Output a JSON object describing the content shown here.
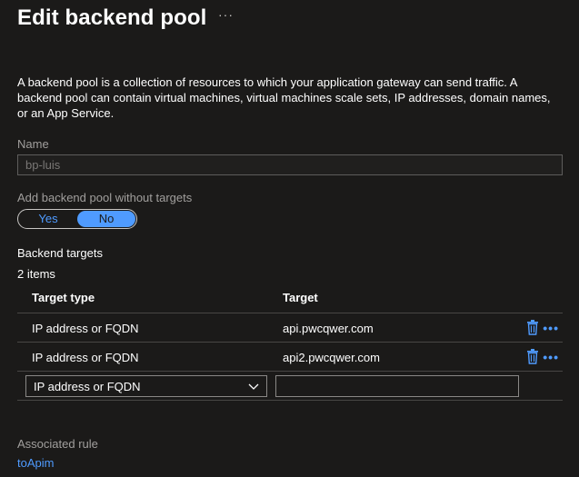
{
  "header": {
    "title": "Edit backend pool",
    "more_label": "···"
  },
  "description": "A backend pool is a collection of resources to which your application gateway can send traffic. A backend pool can contain virtual machines, virtual machines scale sets, IP addresses, domain names, or an App Service.",
  "name_field": {
    "label": "Name",
    "value": "bp-luis"
  },
  "without_targets": {
    "label": "Add backend pool without targets",
    "yes_label": "Yes",
    "no_label": "No",
    "selected": "No"
  },
  "backend_targets": {
    "heading": "Backend targets",
    "count_text": "2 items",
    "columns": [
      "Target type",
      "Target"
    ],
    "rows": [
      {
        "type": "IP address or FQDN",
        "target": "api.pwcqwer.com"
      },
      {
        "type": "IP address or FQDN",
        "target": "api2.pwcqwer.com"
      }
    ],
    "new_row": {
      "type_selected": "IP address or FQDN",
      "target_value": ""
    }
  },
  "associated_rule": {
    "label": "Associated rule",
    "link_text": "toApim"
  },
  "colors": {
    "background": "#1b1a19",
    "accent": "#4f9bff",
    "muted_text": "#a19f9d"
  },
  "icons": {
    "delete": "trash-icon",
    "more": "more-options-icon",
    "dropdown": "chevron-down-icon"
  }
}
